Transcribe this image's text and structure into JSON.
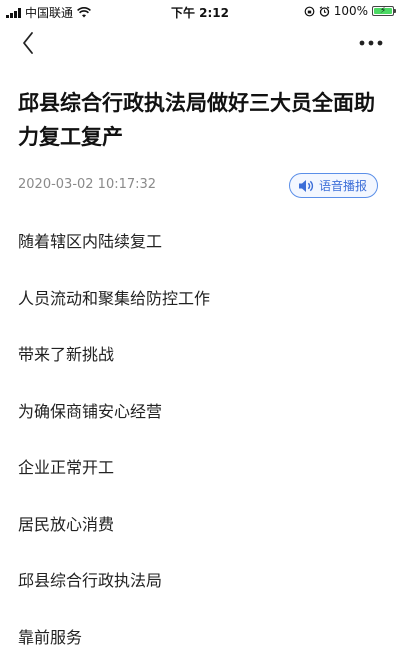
{
  "status_bar": {
    "carrier": "中国联通",
    "time": "下午 2:12",
    "battery_percent_label": "100%",
    "battery_level": 1.0,
    "signal_icon": "signal-icon",
    "wifi_icon": "wifi-icon",
    "alarm_icon": "alarm-icon"
  },
  "nav": {
    "back_icon": "chevron-left-icon",
    "more_icon": "more-dots-icon"
  },
  "article": {
    "title": "邱县综合行政执法局做好三大员全面助力复工复产",
    "publish_time": "2020-03-02 10:17:32",
    "audio_button_label": "语音播报",
    "paragraphs": [
      "随着辖区内陆续复工",
      "人员流动和聚集给防控工作",
      "带来了新挑战",
      "为确保商铺安心经营",
      "企业正常开工",
      "居民放心消费",
      "邱县综合行政执法局",
      "靠前服务"
    ]
  },
  "colors": {
    "accent": "#3d6fd8",
    "accent_bg": "#f3f7ff",
    "meta_text": "#8a8a8a",
    "battery_green": "#4cd964"
  }
}
